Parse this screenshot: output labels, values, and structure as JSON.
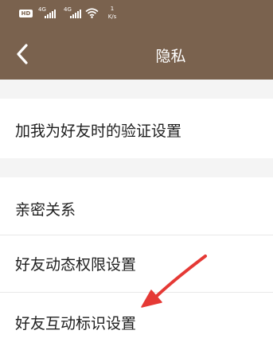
{
  "status_bar": {
    "hd_label": "HD",
    "signal1_label": "4G",
    "signal2_label": "4G",
    "speed_value": "1",
    "speed_unit": "K/s"
  },
  "nav": {
    "title": "隐私"
  },
  "settings": {
    "group1": [
      {
        "label": "加我为好友时的验证设置"
      }
    ],
    "group2": [
      {
        "label": "亲密关系"
      },
      {
        "label": "好友动态权限设置"
      },
      {
        "label": "好友互动标识设置"
      }
    ]
  },
  "colors": {
    "header": "#7a624e",
    "background": "#f4f4f4",
    "row": "#ffffff",
    "text": "#1e1e1e",
    "arrow": "#e53935"
  }
}
